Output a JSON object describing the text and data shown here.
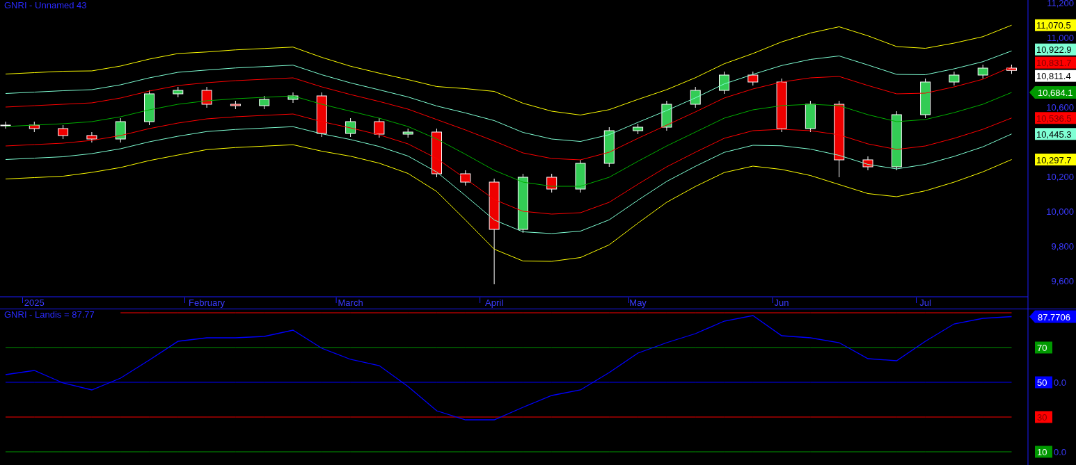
{
  "price_pane": {
    "title": "GNRI - Unnamed 43",
    "chart_data": {
      "type": "candlestick",
      "ylim": [
        9508,
        11216
      ],
      "categories": [
        null,
        "2025",
        null,
        null,
        null,
        null,
        null,
        "February",
        null,
        null,
        null,
        null,
        "March",
        null,
        null,
        null,
        null,
        "April",
        null,
        null,
        null,
        null,
        "May",
        null,
        null,
        null,
        null,
        "Jun",
        null,
        null,
        null,
        null,
        "Jul",
        null,
        null,
        null
      ],
      "yticks": [
        {
          "value": 11200,
          "label": "11,200"
        },
        {
          "value": 11000,
          "label": "11,000"
        },
        {
          "value": 10600,
          "label": "10,600"
        },
        {
          "value": 10200,
          "label": "10,200"
        },
        {
          "value": 10000,
          "label": "10,000"
        },
        {
          "value": 9800,
          "label": "9,800"
        },
        {
          "value": 9600,
          "label": "9,600"
        }
      ],
      "ohlc": [
        [
          10496,
          10516,
          10476,
          10496
        ],
        [
          10496,
          10516,
          10456,
          10476
        ],
        [
          10476,
          10496,
          10416,
          10436
        ],
        [
          10436,
          10456,
          10396,
          10416
        ],
        [
          10416,
          10536,
          10396,
          10516
        ],
        [
          10516,
          10696,
          10496,
          10676
        ],
        [
          10676,
          10716,
          10656,
          10696
        ],
        [
          10696,
          10716,
          10596,
          10616
        ],
        [
          10616,
          10636,
          10588,
          10608
        ],
        [
          10608,
          10664,
          10588,
          10644
        ],
        [
          10644,
          10684,
          10624,
          10664
        ],
        [
          10664,
          10684,
          10428,
          10448
        ],
        [
          10448,
          10536,
          10428,
          10516
        ],
        [
          10516,
          10536,
          10424,
          10444
        ],
        [
          10444,
          10476,
          10424,
          10456
        ],
        [
          10456,
          10476,
          10196,
          10216
        ],
        [
          10216,
          10236,
          10148,
          10168
        ],
        [
          10168,
          10188,
          9580,
          9896
        ],
        [
          9896,
          10216,
          9876,
          10196
        ],
        [
          10196,
          10216,
          10108,
          10128
        ],
        [
          10128,
          10296,
          10108,
          10276
        ],
        [
          10276,
          10484,
          10256,
          10464
        ],
        [
          10464,
          10504,
          10444,
          10484
        ],
        [
          10484,
          10636,
          10464,
          10616
        ],
        [
          10616,
          10716,
          10596,
          10696
        ],
        [
          10696,
          10804,
          10676,
          10784
        ],
        [
          10784,
          10804,
          10724,
          10744
        ],
        [
          10744,
          10764,
          10456,
          10476
        ],
        [
          10476,
          10636,
          10456,
          10616
        ],
        [
          10616,
          10636,
          10196,
          10296
        ],
        [
          10296,
          10316,
          10236,
          10256
        ],
        [
          10256,
          10576,
          10236,
          10556
        ],
        [
          10556,
          10764,
          10536,
          10744
        ],
        [
          10744,
          10804,
          10724,
          10784
        ],
        [
          10784,
          10844,
          10764,
          10824
        ],
        [
          10824,
          10844,
          10791,
          10811
        ]
      ],
      "series": [
        {
          "type": "line",
          "color": "#ffff00",
          "values": [
            10790,
            10798,
            10806,
            10808,
            10836,
            10876,
            10908,
            10917,
            10929,
            10937,
            10945,
            10886,
            10835,
            10795,
            10758,
            10718,
            10706,
            10690,
            10622,
            10576,
            10554,
            10585,
            10644,
            10700,
            10769,
            10849,
            10908,
            10975,
            11026,
            11062,
            11010,
            10948,
            10938,
            10968,
            11005,
            11071
          ]
        },
        {
          "type": "line",
          "color": "#7fffd4",
          "values": [
            10678,
            10686,
            10694,
            10700,
            10728,
            10768,
            10800,
            10813,
            10825,
            10833,
            10841,
            10786,
            10739,
            10699,
            10658,
            10606,
            10566,
            10522,
            10454,
            10416,
            10402,
            10441,
            10512,
            10580,
            10653,
            10733,
            10788,
            10839,
            10874,
            10894,
            10842,
            10788,
            10786,
            10820,
            10861,
            10923
          ]
        },
        {
          "type": "line",
          "color": "#ff0000",
          "values": [
            10600,
            10608,
            10616,
            10624,
            10652,
            10692,
            10724,
            10740,
            10752,
            10760,
            10768,
            10716,
            10672,
            10632,
            10588,
            10528,
            10468,
            10404,
            10336,
            10304,
            10296,
            10340,
            10420,
            10496,
            10572,
            10652,
            10704,
            10744,
            10768,
            10776,
            10724,
            10676,
            10680,
            10716,
            10760,
            10832
          ]
        },
        {
          "type": "line",
          "color": "#00b000",
          "values": [
            10488,
            10496,
            10504,
            10516,
            10544,
            10584,
            10616,
            10636,
            10648,
            10656,
            10664,
            10616,
            10576,
            10536,
            10488,
            10416,
            10328,
            10236,
            10168,
            10144,
            10144,
            10196,
            10288,
            10376,
            10456,
            10536,
            10584,
            10608,
            10616,
            10608,
            10556,
            10516,
            10528,
            10568,
            10616,
            10684
          ]
        },
        {
          "type": "line",
          "color": "#ff0000",
          "values": [
            10376,
            10384,
            10392,
            10408,
            10436,
            10476,
            10508,
            10532,
            10544,
            10552,
            10560,
            10516,
            10480,
            10440,
            10388,
            10304,
            10188,
            10068,
            10000,
            9984,
            9992,
            10052,
            10156,
            10256,
            10340,
            10420,
            10464,
            10472,
            10464,
            10440,
            10388,
            10356,
            10376,
            10420,
            10472,
            10537
          ]
        },
        {
          "type": "line",
          "color": "#7fffd4",
          "values": [
            10298,
            10306,
            10314,
            10332,
            10360,
            10400,
            10432,
            10459,
            10471,
            10479,
            10487,
            10446,
            10413,
            10373,
            10318,
            10226,
            10090,
            9950,
            9882,
            9872,
            9886,
            9951,
            10064,
            10172,
            10259,
            10339,
            10380,
            10377,
            10358,
            10322,
            10270,
            10244,
            10270,
            10316,
            10371,
            10445
          ]
        },
        {
          "type": "line",
          "color": "#ffff00",
          "values": [
            10186,
            10194,
            10202,
            10224,
            10252,
            10292,
            10324,
            10355,
            10367,
            10375,
            10383,
            10346,
            10317,
            10277,
            10218,
            10114,
            9950,
            9782,
            9714,
            9712,
            9734,
            9807,
            9932,
            10052,
            10143,
            10223,
            10260,
            10241,
            10206,
            10154,
            10102,
            10084,
            10118,
            10168,
            10227,
            10298
          ]
        }
      ]
    },
    "markers": [
      {
        "kind": "box",
        "text": "11,070.5",
        "color": "#ffff00"
      },
      {
        "kind": "box",
        "text": "10,922.9",
        "color": "#7fffd4"
      },
      {
        "kind": "box",
        "text": "10,831.7",
        "color": "#ff0000"
      },
      {
        "kind": "close",
        "text": "10,811.4",
        "color": "#ffffff"
      },
      {
        "kind": "arrow",
        "text": "10,684.1",
        "color": "#009900"
      },
      {
        "kind": "box",
        "text": "10,536.5",
        "color": "#ff0000"
      },
      {
        "kind": "box",
        "text": "10,445.3",
        "color": "#7fffd4"
      },
      {
        "kind": "box",
        "text": "10,297.7",
        "color": "#ffff00"
      }
    ]
  },
  "indicator_pane": {
    "title": "GNRI - Landis = 87.77",
    "last_label": "87.7706",
    "axis_fragments": [
      "0.0",
      "0.0"
    ],
    "chart_data": {
      "type": "line",
      "ylim": [
        2.4,
        92.4
      ],
      "yticks": [
        {
          "value": 70,
          "label": "70"
        },
        {
          "value": 50,
          "label": "50"
        },
        {
          "value": 30,
          "label": "30"
        },
        {
          "value": 10,
          "label": "10"
        }
      ],
      "series": [
        {
          "color": "#ff0000",
          "values": [
            null,
            null,
            null,
            null,
            90,
            90,
            90,
            90,
            90,
            90,
            90,
            90,
            90,
            90,
            90,
            90,
            90,
            90,
            90,
            90,
            90,
            90,
            90,
            90,
            90,
            90,
            90,
            90,
            90,
            90,
            90,
            90,
            90,
            90,
            90,
            90
          ]
        },
        {
          "color": "#009900",
          "values": [
            70,
            70,
            70,
            70,
            70,
            70,
            70,
            70,
            70,
            70,
            70,
            70,
            70,
            70,
            70,
            70,
            70,
            70,
            70,
            70,
            70,
            70,
            70,
            70,
            70,
            70,
            70,
            70,
            70,
            70,
            70,
            70,
            70,
            70,
            70,
            70
          ]
        },
        {
          "color": "#0000ff",
          "values": [
            50,
            50,
            50,
            50,
            50,
            50,
            50,
            50,
            50,
            50,
            50,
            50,
            50,
            50,
            50,
            50,
            50,
            50,
            50,
            50,
            50,
            50,
            50,
            50,
            50,
            50,
            50,
            50,
            50,
            50,
            50,
            50,
            50,
            50,
            50,
            50
          ]
        },
        {
          "color": "#ff0000",
          "values": [
            30,
            30,
            30,
            30,
            30,
            30,
            30,
            30,
            30,
            30,
            30,
            30,
            30,
            30,
            30,
            30,
            30,
            30,
            30,
            30,
            30,
            30,
            30,
            30,
            30,
            30,
            30,
            30,
            30,
            30,
            30,
            30,
            30,
            30,
            30,
            30
          ]
        },
        {
          "color": "#009900",
          "values": [
            10,
            10,
            10,
            10,
            10,
            10,
            10,
            10,
            10,
            10,
            10,
            10,
            10,
            10,
            10,
            10,
            10,
            10,
            10,
            10,
            10,
            10,
            10,
            10,
            10,
            10,
            10,
            10,
            10,
            10,
            10,
            10,
            10,
            10,
            10,
            10
          ]
        },
        {
          "color": "#0000ff",
          "values": [
            54.4,
            56.8,
            49.6,
            45.6,
            52.4,
            62.8,
            73.6,
            75.6,
            75.6,
            76.4,
            80,
            69.6,
            63.2,
            59.6,
            47.6,
            33.6,
            28.4,
            28.4,
            35.6,
            42.4,
            45.6,
            55.6,
            66.8,
            72.8,
            78,
            85.2,
            88.4,
            76.8,
            75.6,
            72.8,
            63.6,
            62.4,
            73.6,
            83.6,
            86.8,
            87.8
          ]
        }
      ]
    }
  }
}
